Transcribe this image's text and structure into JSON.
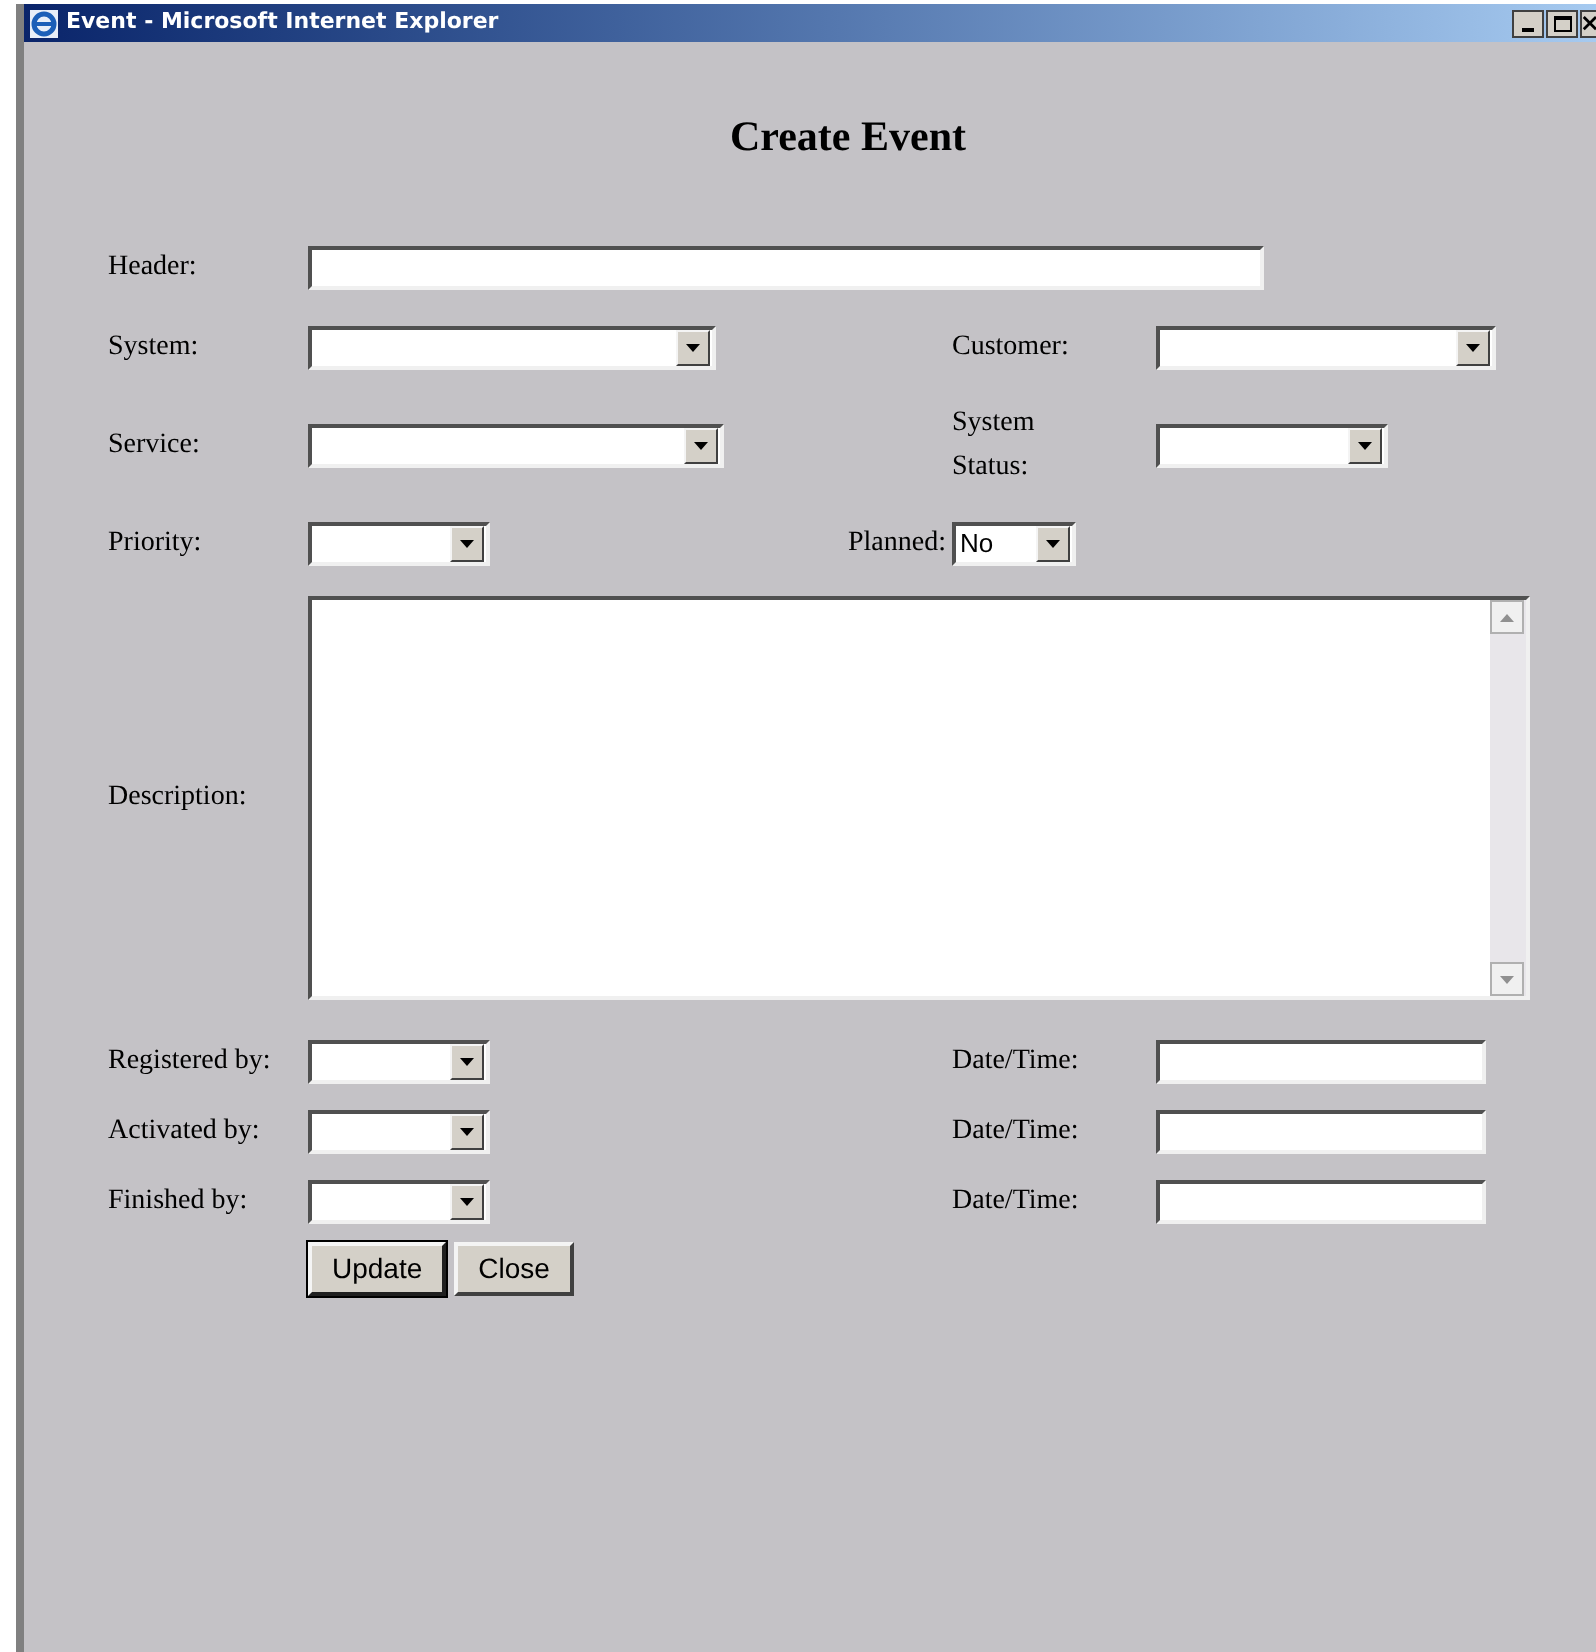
{
  "window": {
    "title": "Event - Microsoft Internet Explorer"
  },
  "heading": "Create Event",
  "header": {
    "label": "Header:"
  },
  "system": {
    "label": "System:"
  },
  "customer": {
    "label": "Customer:"
  },
  "service": {
    "label": "Service:"
  },
  "system_status": {
    "label": "System Status:"
  },
  "priority": {
    "label": "Priority:"
  },
  "planned": {
    "label": "Planned:",
    "value": "No"
  },
  "description": {
    "label": "Description:"
  },
  "people": [
    {
      "label": "Registered by:",
      "datetime_label": "Date/Time:"
    },
    {
      "label": "Activated by:",
      "datetime_label": "Date/Time:"
    },
    {
      "label": "Finished by:",
      "datetime_label": "Date/Time:"
    }
  ],
  "buttons": [
    "Update",
    "Close"
  ]
}
